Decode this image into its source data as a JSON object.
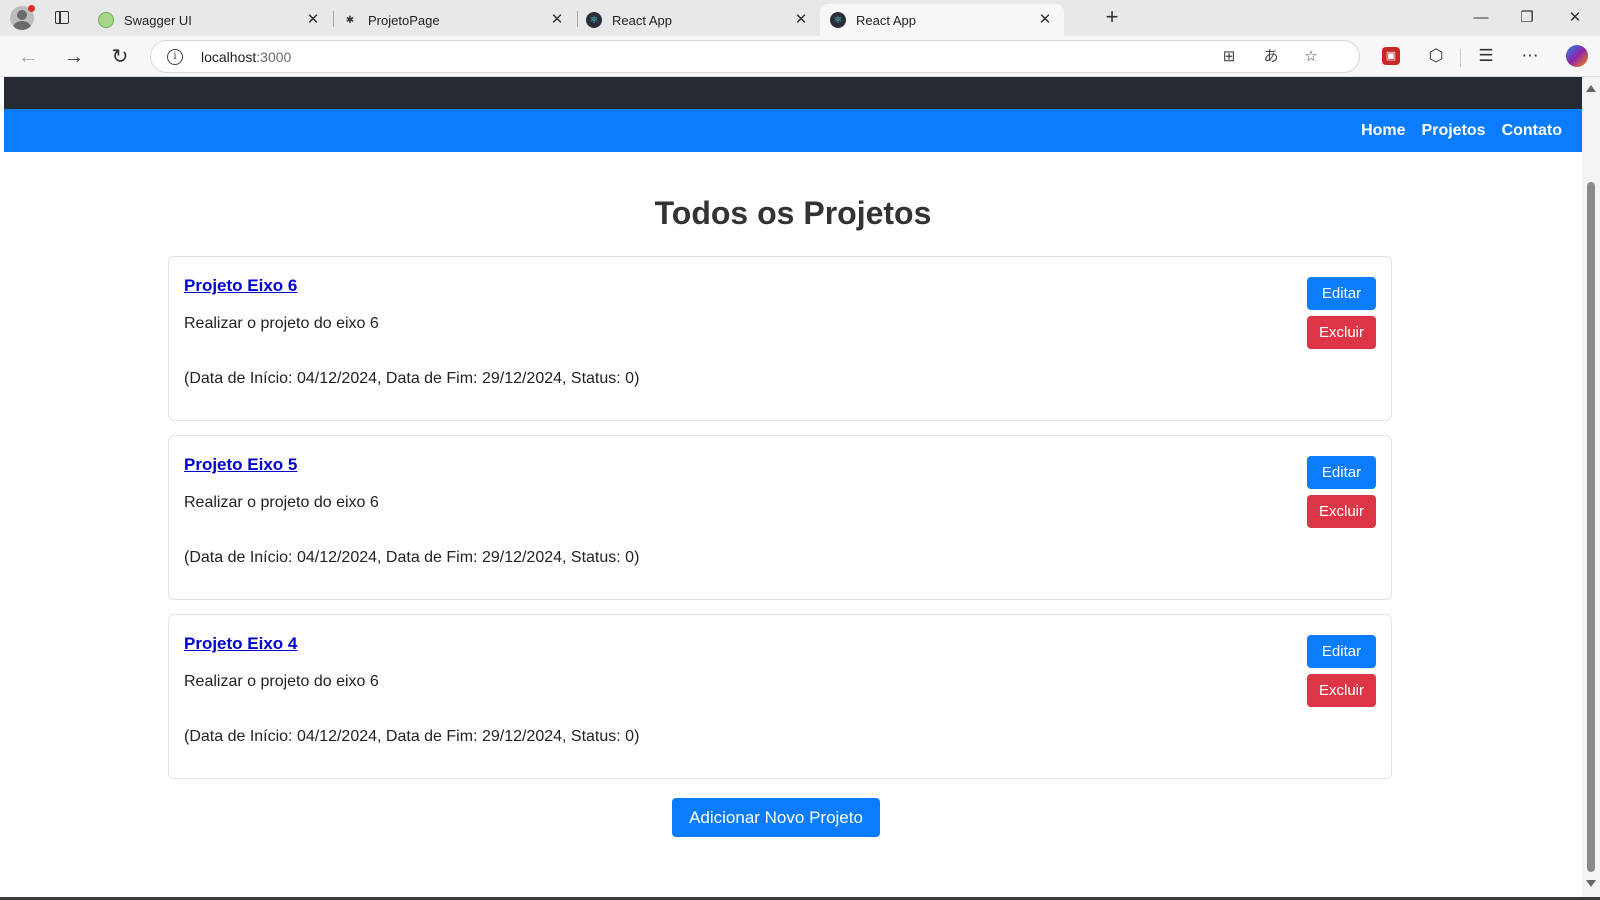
{
  "browser": {
    "tabs": [
      {
        "title": "Swagger UI",
        "favicon": "swagger-icon",
        "active": false
      },
      {
        "title": "ProjetoPage",
        "favicon": "puzzle-icon",
        "active": false
      },
      {
        "title": "React App",
        "favicon": "react-icon",
        "active": false
      },
      {
        "title": "React App",
        "favicon": "react-icon",
        "active": true
      }
    ],
    "close_glyph": "✕",
    "new_tab_glyph": "+",
    "url_host": "localhost",
    "url_port": ":3000",
    "window_controls": {
      "minimize": "—",
      "restore": "❐",
      "close": "✕"
    }
  },
  "navbar": {
    "links": [
      "Home",
      "Projetos",
      "Contato"
    ],
    "background": "#0a7cff"
  },
  "page": {
    "title": "Todos os Projetos",
    "add_button": "Adicionar Novo Projeto"
  },
  "projects": [
    {
      "name": "Projeto Eixo 6",
      "description": "Realizar o projeto do eixo 6",
      "meta": "(Data de Início: 04/12/2024, Data de Fim: 29/12/2024, Status: 0)",
      "edit_label": "Editar",
      "delete_label": "Excluir"
    },
    {
      "name": "Projeto Eixo 5",
      "description": "Realizar o projeto do eixo 6",
      "meta": "(Data de Início: 04/12/2024, Data de Fim: 29/12/2024, Status: 0)",
      "edit_label": "Editar",
      "delete_label": "Excluir"
    },
    {
      "name": "Projeto Eixo 4",
      "description": "Realizar o projeto do eixo 6",
      "meta": "(Data de Início: 04/12/2024, Data de Fim: 29/12/2024, Status: 0)",
      "edit_label": "Editar",
      "delete_label": "Excluir"
    }
  ],
  "colors": {
    "primary": "#0a7cff",
    "danger": "#dc3545",
    "header_dark": "#262b33",
    "link": "#0000cc"
  }
}
